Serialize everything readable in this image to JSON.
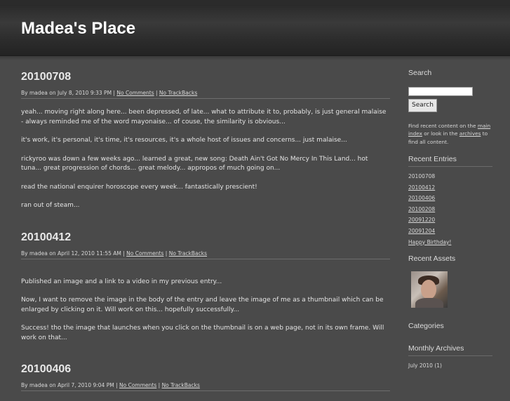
{
  "site": {
    "title": "Madea's Place"
  },
  "entries": [
    {
      "title": "20100708",
      "meta_prefix": "By madea on July 8, 2010 9:33 PM | ",
      "comments": "No Comments",
      "sep": " | ",
      "trackbacks": "No TrackBacks",
      "paragraphs": [
        "yeah... moving right along here... been depressed, of late... what to attribute it to, probably, is just general malaise - always reminded me of the word mayonaise... of couse, the similarity is obvious...",
        "it's work, it's personal, it's time, it's resources, it's a whole host of issues and concerns... just malaise...",
        "rickyroo was down a few weeks ago... learned a great, new song: Death Ain't Got No Mercy In This Land... hot tuna... great progression of chords... great melody... appropos of much going on...",
        "read the national enquirer horoscope every week... fantastically prescient!",
        "ran out of steam..."
      ]
    },
    {
      "title": "20100412",
      "meta_prefix": "By madea on April 12, 2010 11:55 AM | ",
      "comments": "No Comments",
      "sep": " | ",
      "trackbacks": "No TrackBacks",
      "paragraphs": [
        "Published an image and a link to a video in my previous entry...",
        "Now, I want to remove the image in the body of the entry and leave the image of me as a thumbnail which can be enlarged by clicking on it.  Will work on this... hopefully successfully...",
        "Success! tho the image that launches  when you click on the thumbnail is on a web page, not in its own frame.  Will work on that..."
      ]
    },
    {
      "title": "20100406",
      "meta_prefix": "By madea on April 7, 2010 9:04 PM | ",
      "comments": "No Comments",
      "sep": " | ",
      "trackbacks": "No TrackBacks",
      "paragraphs": []
    }
  ],
  "sidebar": {
    "search": {
      "heading": "Search",
      "button": "Search",
      "note_1": "Find recent content on the ",
      "link_main": "main index",
      "note_2": " or look in the ",
      "link_archives": "archives",
      "note_3": " to find all content."
    },
    "recent_entries": {
      "heading": "Recent Entries",
      "items": [
        "20100708",
        "20100412",
        "20100406",
        "20100208",
        "20091220",
        "20091204",
        "Happy Birthday!"
      ]
    },
    "recent_assets": {
      "heading": "Recent Assets"
    },
    "categories": {
      "heading": "Categories"
    },
    "monthly_archives": {
      "heading": "Monthly Archives",
      "items": [
        "July 2010 (1)"
      ]
    }
  }
}
